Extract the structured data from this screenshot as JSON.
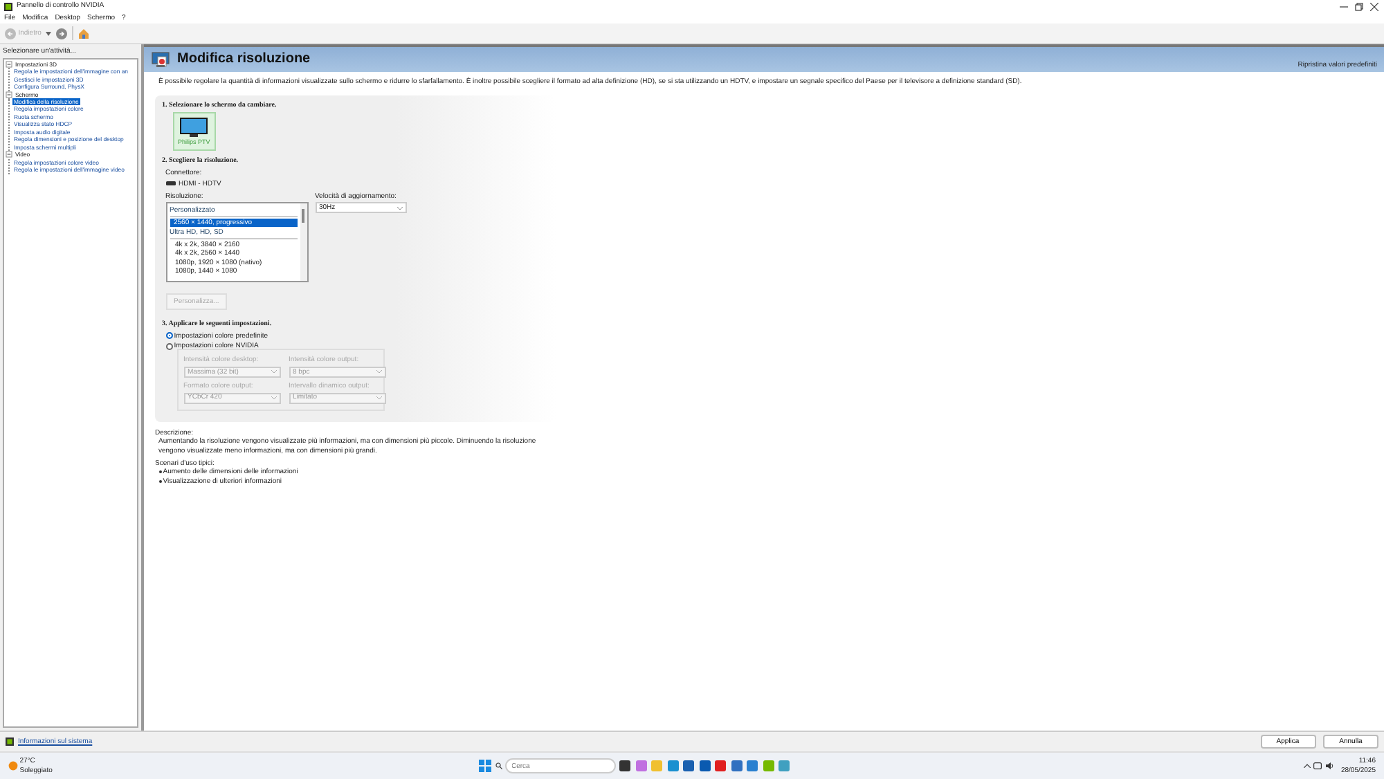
{
  "window": {
    "title": "Pannello di controllo NVIDIA"
  },
  "menu": [
    "File",
    "Modifica",
    "Desktop",
    "Schermo",
    "?"
  ],
  "toolbar": {
    "back": {
      "label": "Indietro",
      "disabled": true
    }
  },
  "sidebar": {
    "heading": "Selezionare un'attività...",
    "tasks": [
      {
        "label": "Impostazioni 3D",
        "expanded": true,
        "children": [
          {
            "label": "Regola le impostazioni dell'immagine con an",
            "selected": false
          },
          {
            "label": "Gestisci le impostazioni 3D",
            "selected": false
          },
          {
            "label": "Configura Surround, PhysX",
            "selected": false
          }
        ]
      },
      {
        "label": "Schermo",
        "expanded": true,
        "children": [
          {
            "label": "Modifica della risoluzione",
            "selected": true
          },
          {
            "label": "Regola impostazioni colore",
            "selected": false
          },
          {
            "label": "Ruota schermo",
            "selected": false
          },
          {
            "label": "Visualizza stato HDCP",
            "selected": false
          },
          {
            "label": "Imposta audio digitale",
            "selected": false
          },
          {
            "label": "Regola dimensioni e posizione del desktop",
            "selected": false
          },
          {
            "label": "Imposta schermi multipli",
            "selected": false
          }
        ]
      },
      {
        "label": "Video",
        "expanded": true,
        "children": [
          {
            "label": "Regola impostazioni colore video",
            "selected": false
          },
          {
            "label": "Regola le impostazioni dell'immagine video",
            "selected": false
          }
        ]
      }
    ]
  },
  "page": {
    "title": "Modifica risoluzione",
    "reset_link": "Ripristina valori predefiniti",
    "intro": "È possibile regolare la quantità di informazioni visualizzate sullo schermo e ridurre lo sfarfallamento. È inoltre possibile scegliere il formato ad alta definizione (HD), se si sta utilizzando un HDTV, e impostare un segnale specifico del Paese per il televisore a definizione standard (SD)."
  },
  "section1": {
    "title": "1. Selezionare lo schermo da cambiare.",
    "displays": [
      {
        "label": "Philips PTV",
        "selected": true
      }
    ]
  },
  "section2": {
    "title": "2. Scegliere la risoluzione.",
    "connector_label": "Connettore:",
    "connector": "HDMI - HDTV",
    "resolution_label": "Risoluzione:",
    "resolution_groups": [
      {
        "header": "Personalizzato",
        "items": [
          {
            "label": "2560 × 1440, progressivo",
            "selected": true
          }
        ]
      },
      {
        "header": "Ultra HD, HD, SD",
        "items": [
          {
            "label": "4k x 2k, 3840 × 2160",
            "selected": false
          },
          {
            "label": "4k x 2k, 2560 × 1440",
            "selected": false
          },
          {
            "label": "1080p, 1920 × 1080 (nativo)",
            "selected": false
          },
          {
            "label": "1080p, 1440 × 1080",
            "selected": false
          }
        ]
      }
    ],
    "refresh_label": "Velocità di aggiornamento:",
    "refresh_value": "30Hz",
    "customize_button": {
      "label": "Personalizza...",
      "disabled": true
    }
  },
  "section3": {
    "title": "3. Applicare le seguenti impostazioni.",
    "options": [
      {
        "label": "Impostazioni colore predefinite",
        "selected": true
      },
      {
        "label": "Impostazioni colore NVIDIA",
        "selected": false
      }
    ],
    "fields": [
      {
        "label": "Intensità colore desktop:",
        "value": "Massima (32 bit)",
        "disabled": true
      },
      {
        "label": "Intensità colore output:",
        "value": "8 bpc",
        "disabled": true
      },
      {
        "label": "Formato colore output:",
        "value": "YCbCr 420",
        "disabled": true
      },
      {
        "label": "Intervallo dinamico output:",
        "value": "Limitato",
        "disabled": true
      }
    ]
  },
  "description": {
    "label": "Descrizione:",
    "text": "Aumentando la risoluzione vengono visualizzate più informazioni, ma con dimensioni più piccole. Diminuendo la risoluzione vengono visualizzate meno informazioni, ma con dimensioni più grandi."
  },
  "scenarios": {
    "label": "Scenari d'uso tipici:",
    "items": [
      "Aumento delle dimensioni delle informazioni",
      "Visualizzazione di ulteriori informazioni"
    ]
  },
  "footer": {
    "system_info_link": "Informazioni sul sistema",
    "buttons": [
      "Applica",
      "Annulla"
    ]
  },
  "taskbar": {
    "weather": {
      "temperature": "27°C",
      "condition": "Soleggiato"
    },
    "search_placeholder": "Cerca",
    "time": "11:46",
    "date": "28/05/2025"
  }
}
